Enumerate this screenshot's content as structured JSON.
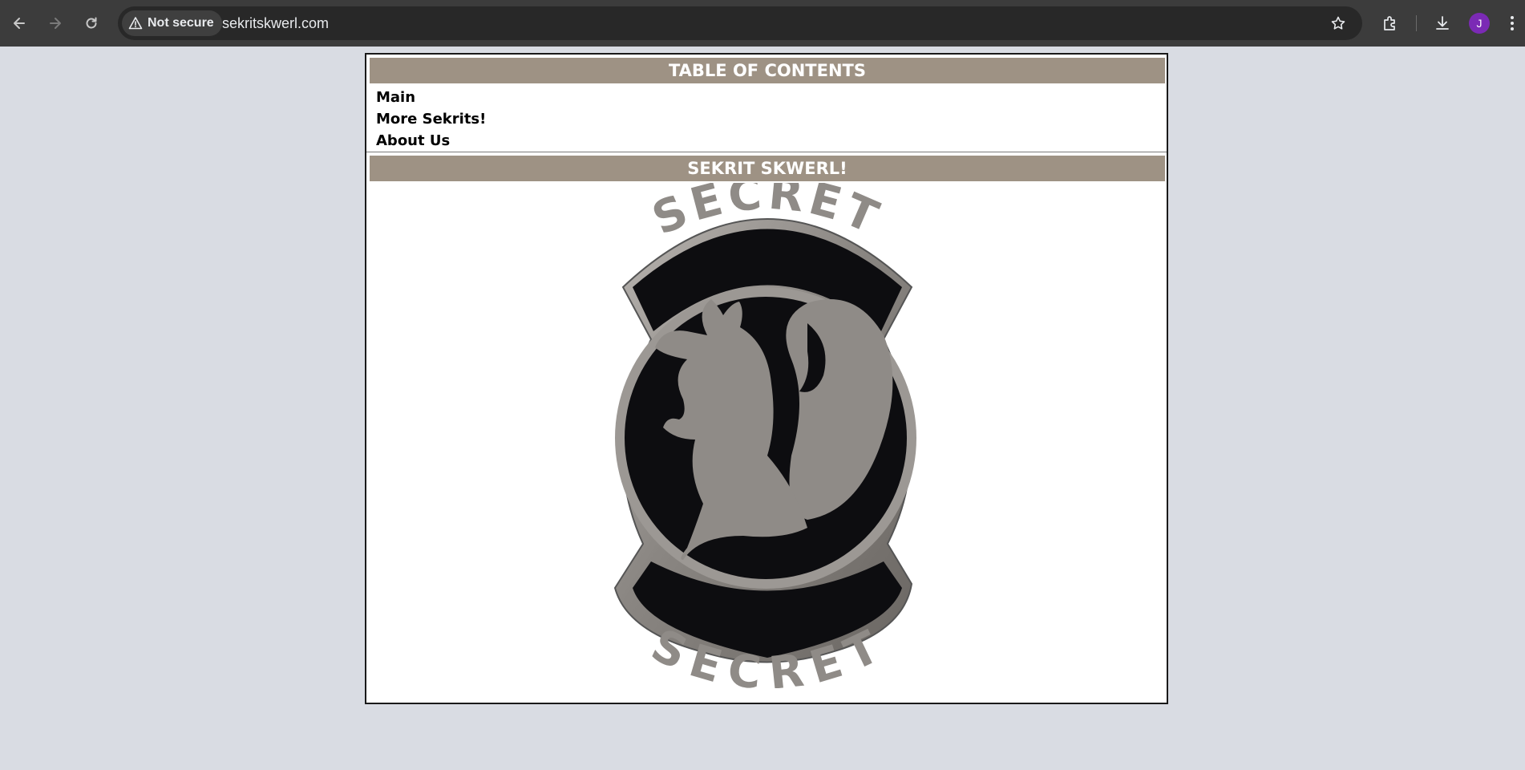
{
  "browser": {
    "security_label": "Not secure",
    "url": "sekritskwerl.com",
    "avatar_initial": "J",
    "avatar_color": "#7b2ab5",
    "icons": [
      "back-icon",
      "forward-icon",
      "reload-icon",
      "warning-icon",
      "star-icon",
      "extensions-icon",
      "download-icon",
      "menu-icon"
    ]
  },
  "toc": {
    "title": "TABLE OF CONTENTS",
    "links": [
      {
        "label": "Main"
      },
      {
        "label": "More Sekrits!"
      },
      {
        "label": "About Us"
      }
    ]
  },
  "main": {
    "title": "SEKRIT SKWERL!",
    "image": {
      "top_text": "SECRET",
      "bottom_text": "SECRET"
    }
  },
  "colors": {
    "header_bg": "#9e9284",
    "page_bg": "#d9dce3",
    "badge_dark": "#0d0d10",
    "badge_metal": "#8e8a86"
  }
}
